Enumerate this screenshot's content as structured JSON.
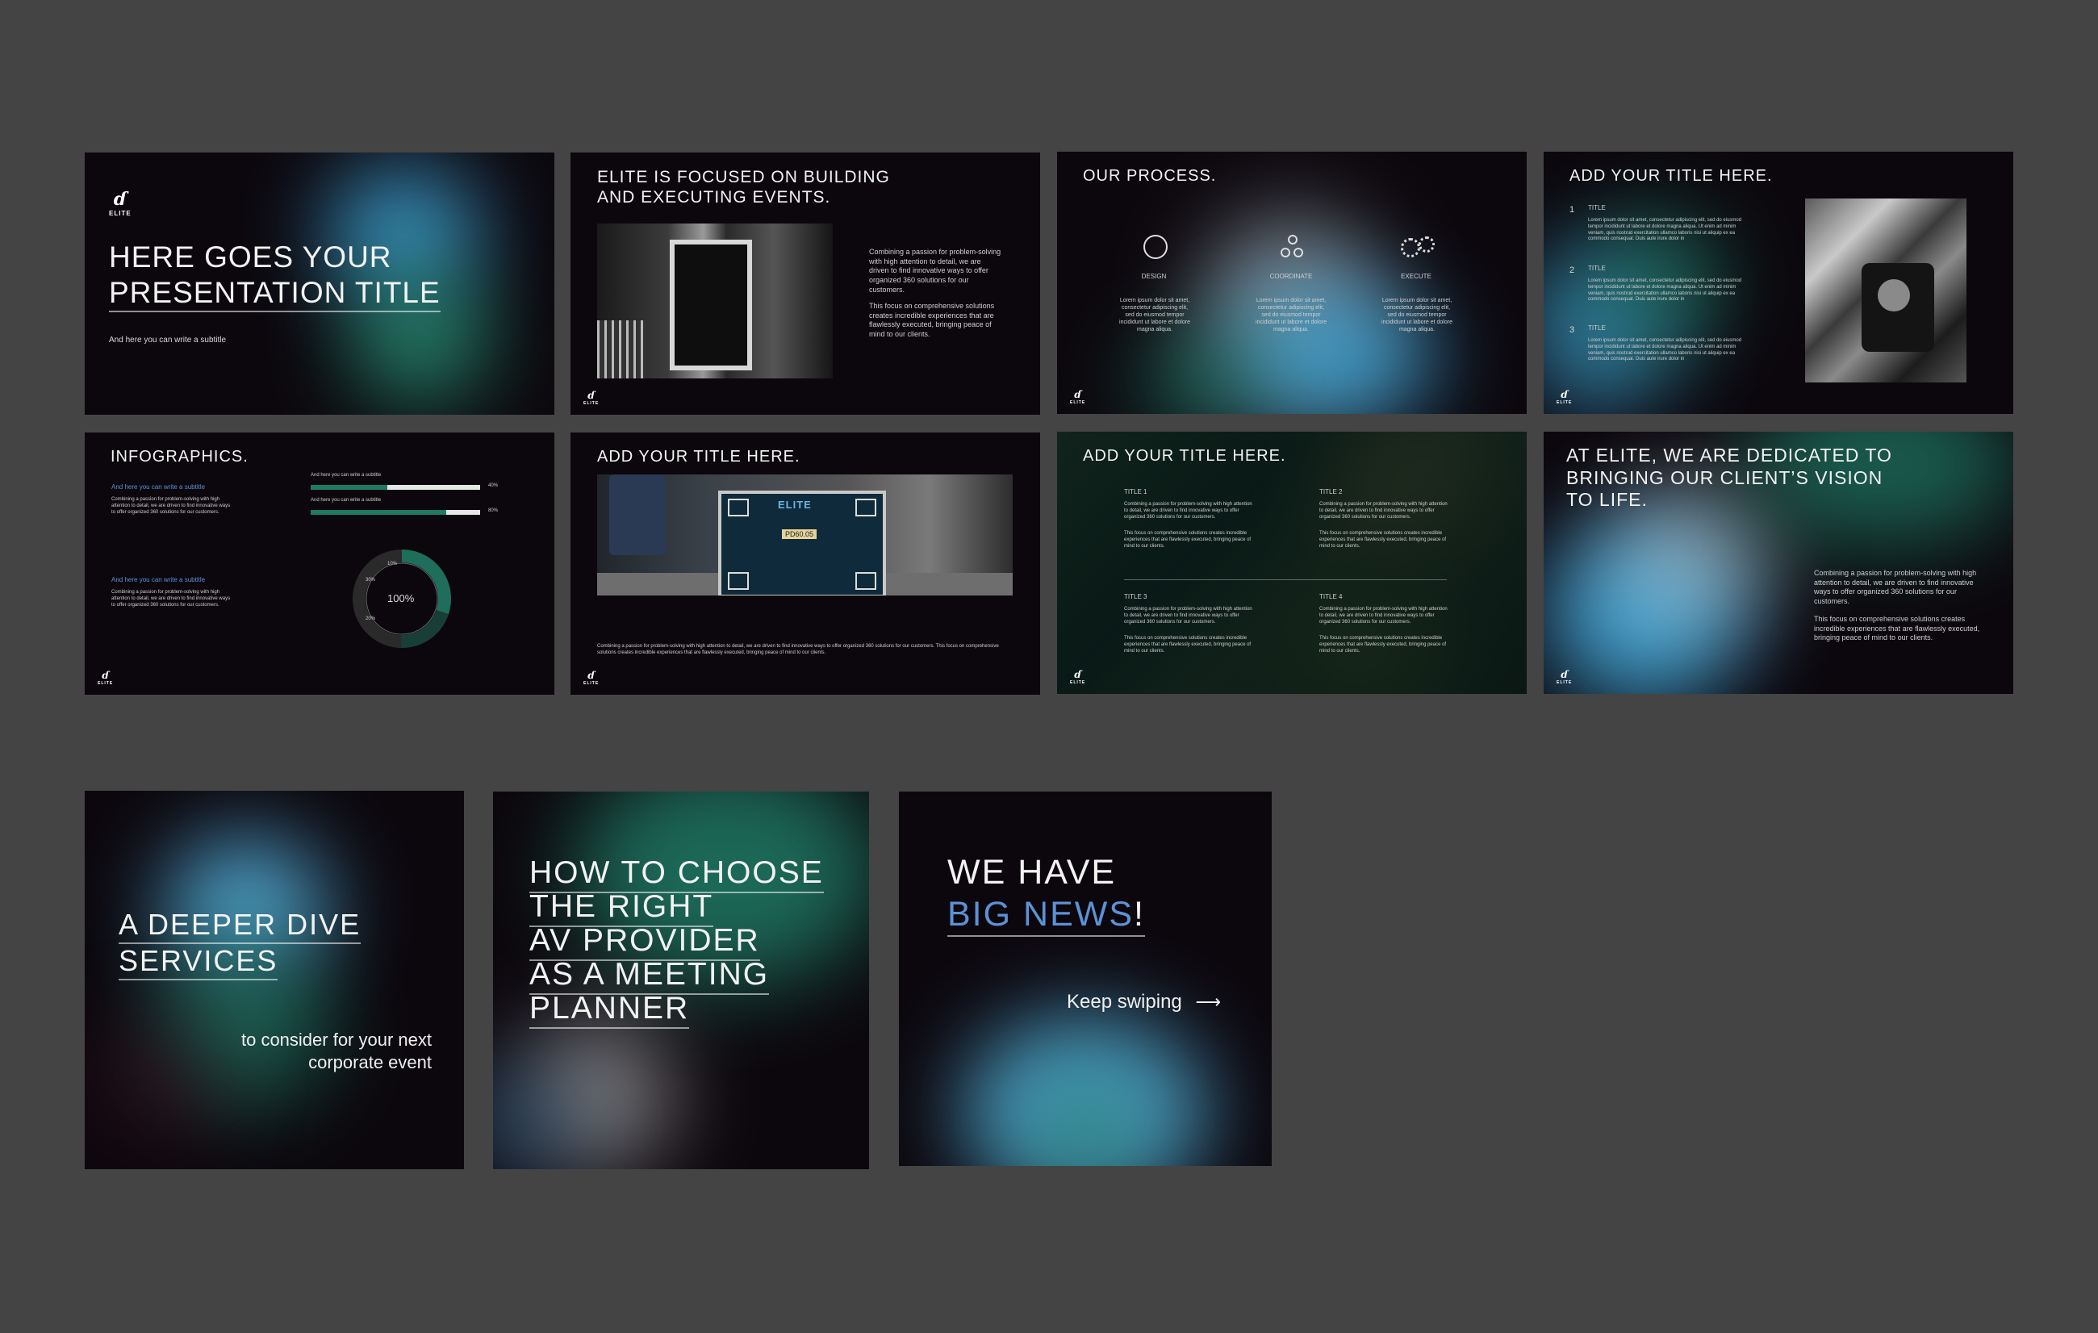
{
  "slides": {
    "s1": {
      "title_l1": "HERE GOES YOUR",
      "title_l2": "PRESENTATION TITLE",
      "subtitle": "And here you can write a subtitle",
      "logo_text": "ELITE"
    },
    "s2": {
      "title_l1": "ELITE IS FOCUSED ON BUILDING",
      "title_l2": "AND EXECUTING EVENTS.",
      "para1": "Combining a passion for problem-solving with high attention to detail, we are driven to find innovative ways to offer organized 360 solutions for our customers.",
      "para2": "This focus on comprehensive solutions creates incredible experiences that are flawlessly executed, bringing peace of mind to our clients."
    },
    "s3": {
      "title": "OUR PROCESS.",
      "steps": [
        "DESIGN",
        "COORDINATE",
        "EXECUTE"
      ],
      "step_text": "Lorem ipsum dolor sit amet, consectetur adipiscing elit, sed do eiusmod tempor incididunt ut labore et dolore magna aliqua."
    },
    "s4": {
      "title": "ADD YOUR TITLE HERE.",
      "items": [
        {
          "num": "1",
          "label": "TITLE",
          "text": "Lorem ipsum dolor sit amet, consectetur adipiscing elit, sed do eiusmod tempor incididunt ut labore et dolore magna aliqua. Ut enim ad minim veniam, quis nostrud exercitation ullamco laboris nisi ut aliquip ex ea commodo consequat. Duis aute irure dolor in"
        },
        {
          "num": "2",
          "label": "TITLE",
          "text": "Lorem ipsum dolor sit amet, consectetur adipiscing elit, sed do eiusmod tempor incididunt ut labore et dolore magna aliqua. Ut enim ad minim veniam, quis nostrud exercitation ullamco laboris nisi ut aliquip ex ea commodo consequat. Duis aute irure dolor in"
        },
        {
          "num": "3",
          "label": "TITLE",
          "text": "Lorem ipsum dolor sit amet, consectetur adipiscing elit, sed do eiusmod tempor incididunt ut labore et dolore magna aliqua. Ut enim ad minim veniam, quis nostrud exercitation ullamco laboris nisi ut aliquip ex ea commodo consequat. Duis aute irure dolor in"
        }
      ]
    },
    "s5": {
      "title": "INFOGRAPHICS.",
      "sub1": "And here you can write a subtitle",
      "text1": "Combining a passion for problem-solving with high attention to detail, we are driven to find innovative ways to offer organized 360 solutions for our customers.",
      "sub2": "And here you can write a subtitle",
      "text2": "Combining a passion for problem-solving with high attention to detail, we are driven to find innovative ways to offer organized 360 solutions for our customers.",
      "bar1_label": "And here you can write a subtitle",
      "bar1_value": "40%",
      "bar1_fill": 0.45,
      "bar2_label": "And here you can write a subtitle",
      "bar2_value": "80%",
      "bar2_fill": 0.8,
      "donut_center": "100%",
      "donut_labels": [
        "10%",
        "30%",
        "20%"
      ]
    },
    "s6": {
      "title": "ADD YOUR TITLE HERE.",
      "case_brand": "ELITE",
      "case_code": "PD60.05",
      "caption": "Combining a passion for problem-solving with high attention to detail, we are driven to find innovative ways to offer organized 360 solutions for our customers. This focus on comprehensive solutions creates incredible experiences that are flawlessly executed, bringing peace of mind to our clients."
    },
    "s7": {
      "title": "ADD YOUR TITLE HERE.",
      "blocks": [
        {
          "label": "TITLE 1",
          "text": "Combining a passion for problem-solving with high attention to detail, we are driven to find innovative ways to offer organized 360 solutions for our customers.",
          "text2": "This focus on comprehensive solutions creates incredible experiences that are flawlessly executed, bringing peace of mind to our clients."
        },
        {
          "label": "TITLE 2",
          "text": "Combining a passion for problem-solving with high attention to detail, we are driven to find innovative ways to offer organized 360 solutions for our customers.",
          "text2": "This focus on comprehensive solutions creates incredible experiences that are flawlessly executed, bringing peace of mind to our clients."
        },
        {
          "label": "TITLE 3",
          "text": "Combining a passion for problem-solving with high attention to detail, we are driven to find innovative ways to offer organized 360 solutions for our customers.",
          "text2": "This focus on comprehensive solutions creates incredible experiences that are flawlessly executed, bringing peace of mind to our clients."
        },
        {
          "label": "TITLE 4",
          "text": "Combining a passion for problem-solving with high attention to detail, we are driven to find innovative ways to offer organized 360 solutions for our customers.",
          "text2": "This focus on comprehensive solutions creates incredible experiences that are flawlessly executed, bringing peace of mind to our clients."
        }
      ]
    },
    "s8": {
      "title_l1": "AT ELITE, WE ARE DEDICATED TO",
      "title_l2": "BRINGING OUR CLIENT’S VISION",
      "title_l3": "TO LIFE.",
      "para1": "Combining a passion for problem-solving with high attention to detail, we are driven to find innovative ways to offer organized 360 solutions for our customers.",
      "para2": "This focus on comprehensive solutions creates incredible experiences that are flawlessly executed, bringing peace of mind to our clients."
    },
    "p1": {
      "title_l1": "A DEEPER DIVE",
      "title_l2": "SERVICES",
      "sub_l1": "to consider for your next",
      "sub_l2": "corporate event"
    },
    "p2": {
      "l1": "HOW TO CHOOSE",
      "l2": "THE RIGHT",
      "l3": "AV PROVIDER",
      "l4": "AS A MEETING",
      "l5": "PLANNER"
    },
    "p3": {
      "l1": "WE HAVE",
      "l2": "BIG NEWS",
      "bang": "!",
      "swipe": "Keep swiping"
    }
  },
  "colors": {
    "canvas": "#444444",
    "slide_bg": "#0c070d",
    "teal": "#1f7a64",
    "sky": "#59b9e8",
    "accent": "#5b92d6"
  }
}
